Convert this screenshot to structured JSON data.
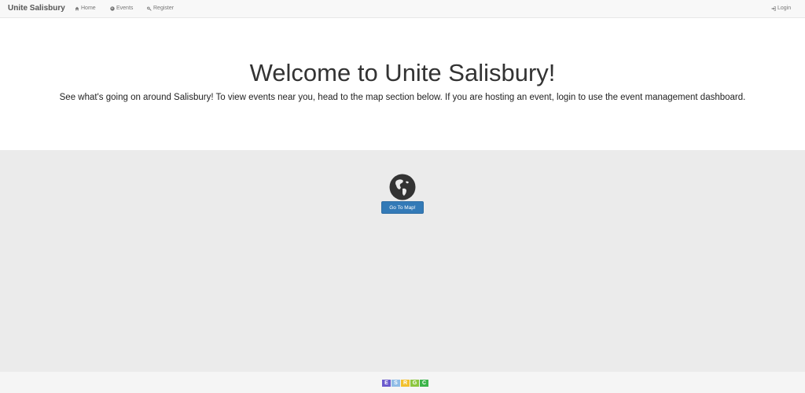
{
  "navbar": {
    "brand": "Unite Salisbury",
    "items": [
      {
        "label": "Home",
        "icon": "home-icon"
      },
      {
        "label": "Events",
        "icon": "globe-icon"
      },
      {
        "label": "Register",
        "icon": "key-icon"
      }
    ],
    "login": {
      "label": "Login",
      "icon": "login-icon"
    }
  },
  "hero": {
    "title": "Welcome to Unite Salisbury!",
    "description": "See what's going on around Salisbury! To view events near you, head to the map section below. If you are hosting an event, login to use the event management dashboard."
  },
  "map_section": {
    "icon": "globe-icon",
    "button_label": "Go To Map!"
  },
  "footer": {
    "logo_letters": [
      "E",
      "S",
      "R",
      "G",
      "C"
    ],
    "logo_colors": [
      "#6a5acd",
      "#8fbce6",
      "#f2c12e",
      "#8cc63f",
      "#3cb44a"
    ]
  },
  "colors": {
    "primary_button": "#337ab7",
    "navbar_bg": "#f8f8f8",
    "section_bg": "#ebebeb"
  }
}
